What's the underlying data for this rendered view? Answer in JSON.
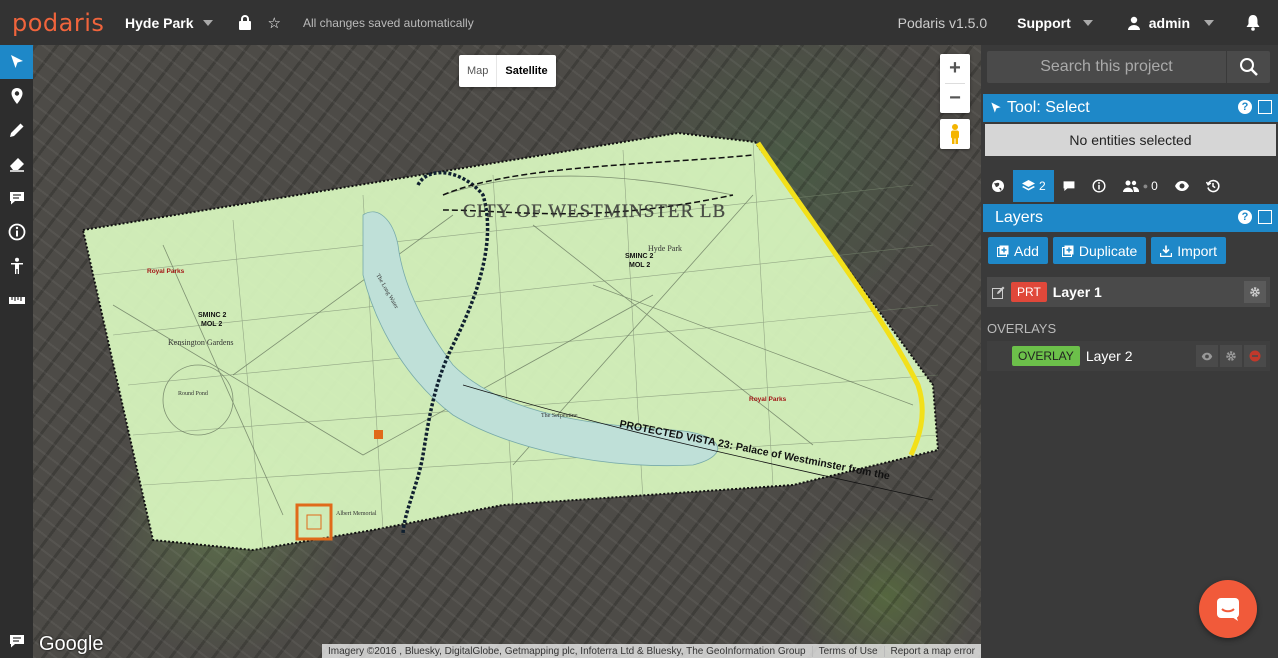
{
  "app": {
    "logo": "podaris",
    "version": "Podaris v1.5.0"
  },
  "header": {
    "project_name": "Hyde Park",
    "saved_status": "All changes saved automatically",
    "support_label": "Support",
    "user_label": "admin"
  },
  "left_tools": [
    "select-arrow-icon",
    "map-pin-icon",
    "pencil-icon",
    "eraser-icon",
    "comment-icon",
    "info-icon",
    "person-icon",
    "ruler-icon"
  ],
  "map": {
    "type_buttons": {
      "map": "Map",
      "satellite": "Satellite"
    },
    "zoom_in": "+",
    "zoom_out": "−",
    "google_logo": "Google",
    "attribution": {
      "imagery": "Imagery ©2016 , Bluesky, DigitalGlobe, Getmapping plc, Infoterra Ltd & Bluesky, The GeoInformation Group",
      "terms": "Terms of Use",
      "report": "Report a map error"
    },
    "overlay_labels": {
      "borough": "CITY OF WESTMINSTER LB",
      "vista": "PROTECTED VISTA 23: Palace of Westminster from the",
      "hyde_park": "Hyde Park",
      "kensington": "Kensington Gardens",
      "sminc_left": "SMINC 2",
      "mol_left": "MOL 2",
      "sminc_right": "SMINC 2",
      "mol_right": "MOL 2",
      "royal_parks_left": "Royal Parks",
      "royal_parks_right": "Royal Parks",
      "round_pond": "Round Pond",
      "serpentine": "The Serpentine",
      "albert_memorial": "Albert Memorial",
      "long_water": "The Long Water"
    },
    "colors": {
      "overlay_fill": "#d9f7c0",
      "water": "#bfe0d8",
      "boundary": "#111111",
      "highlight": "#f2e01a",
      "orange": "#e06a1a"
    }
  },
  "panel": {
    "search_placeholder": "Search this project",
    "tool_header": "Tool: Select",
    "selection_status": "No entities selected",
    "tabs": [
      {
        "icon": "globe-icon",
        "count": ""
      },
      {
        "icon": "layers-icon",
        "count": "2"
      },
      {
        "icon": "comment-icon",
        "count": ""
      },
      {
        "icon": "info-icon",
        "count": ""
      },
      {
        "icon": "users-icon",
        "count": "0"
      },
      {
        "icon": "eye-icon",
        "count": ""
      },
      {
        "icon": "history-icon",
        "count": ""
      }
    ],
    "layers_header": "Layers",
    "buttons": {
      "add": "Add",
      "duplicate": "Duplicate",
      "import": "Import"
    },
    "layer": {
      "badge": "PRT",
      "name": "Layer 1"
    },
    "overlays_label": "OVERLAYS",
    "overlay": {
      "badge": "OVERLAY",
      "name": "Layer 2"
    }
  },
  "accent_color": "#1e88c8"
}
